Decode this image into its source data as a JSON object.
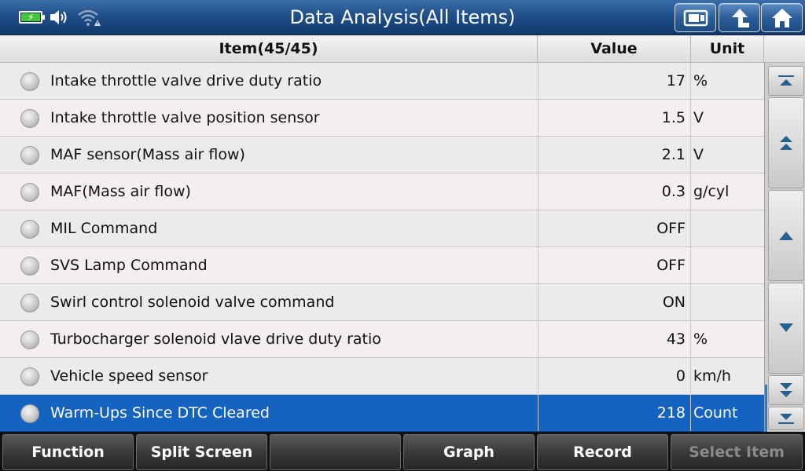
{
  "header": {
    "title": "Data Analysis(All Items)"
  },
  "status_bar": {
    "icons": [
      "battery-charging-icon",
      "speaker-icon",
      "wifi-warning-icon"
    ]
  },
  "title_buttons": [
    "screenshot-icon",
    "back-icon",
    "home-icon"
  ],
  "table": {
    "columns": {
      "item": "Item(45/45)",
      "value": "Value",
      "unit": "Unit"
    },
    "rows": [
      {
        "item": "Intake throttle valve drive duty ratio",
        "value": "17",
        "unit": "%"
      },
      {
        "item": "Intake throttle valve position sensor",
        "value": "1.5",
        "unit": "V"
      },
      {
        "item": "MAF sensor(Mass air flow)",
        "value": "2.1",
        "unit": "V"
      },
      {
        "item": "MAF(Mass air flow)",
        "value": "0.3",
        "unit": "g/cyl"
      },
      {
        "item": "MIL Command",
        "value": "OFF",
        "unit": ""
      },
      {
        "item": "SVS Lamp Command",
        "value": "OFF",
        "unit": ""
      },
      {
        "item": "Swirl control solenoid valve command",
        "value": "ON",
        "unit": ""
      },
      {
        "item": "Turbocharger solenoid vlave drive duty ratio",
        "value": "43",
        "unit": "%"
      },
      {
        "item": "Vehicle speed sensor",
        "value": "0",
        "unit": "km/h"
      },
      {
        "item": "Warm-Ups Since DTC Cleared",
        "value": "218",
        "unit": "Count"
      }
    ],
    "selected_index": 9
  },
  "toolbar": {
    "function": "Function",
    "split_screen": "Split Screen",
    "empty": "",
    "graph": "Graph",
    "record": "Record",
    "select_item": "Select Item"
  },
  "colors": {
    "title_bar": "#1f4f8a",
    "selected_row": "#1463c0",
    "battery_green": "#45c73a"
  }
}
